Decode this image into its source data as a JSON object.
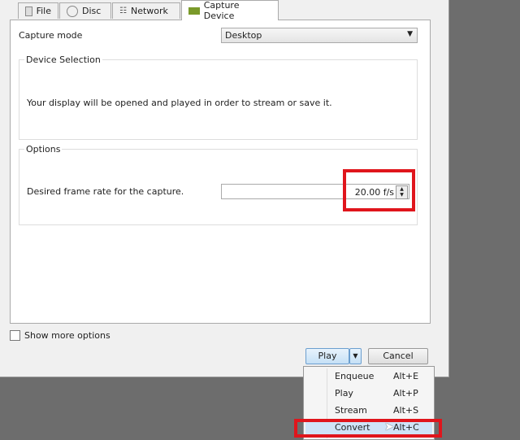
{
  "tabs": [
    {
      "label": "File",
      "icon": "folder-icon"
    },
    {
      "label": "Disc",
      "icon": "disc-icon"
    },
    {
      "label": "Network",
      "icon": "network-icon"
    },
    {
      "label": "Capture Device",
      "icon": "capture-card-icon"
    }
  ],
  "capture_mode": {
    "label": "Capture mode",
    "value": "Desktop"
  },
  "device_selection": {
    "title": "Device Selection",
    "text": "Your display will be opened and played in order to stream or save it."
  },
  "options": {
    "title": "Options",
    "frame_rate_label": "Desired frame rate for the capture.",
    "frame_rate_value": "20.00 f/s"
  },
  "show_more": {
    "label": "Show more options",
    "checked": false
  },
  "buttons": {
    "play": "Play",
    "cancel": "Cancel"
  },
  "menu": [
    {
      "label": "Enqueue",
      "shortcut": "Alt+E"
    },
    {
      "label": "Play",
      "shortcut": "Alt+P"
    },
    {
      "label": "Stream",
      "shortcut": "Alt+S"
    },
    {
      "label": "Convert",
      "shortcut": "Alt+C"
    }
  ],
  "highlight_color": "#e0151c"
}
